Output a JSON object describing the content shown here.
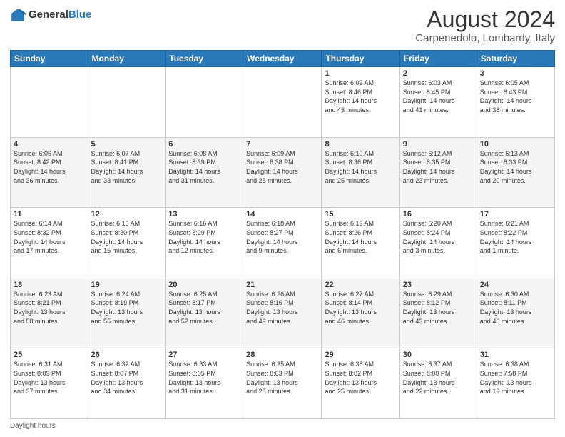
{
  "logo": {
    "general": "General",
    "blue": "Blue"
  },
  "title": "August 2024",
  "subtitle": "Carpenedolo, Lombardy, Italy",
  "footer": "Daylight hours",
  "weekdays": [
    "Sunday",
    "Monday",
    "Tuesday",
    "Wednesday",
    "Thursday",
    "Friday",
    "Saturday"
  ],
  "weeks": [
    [
      {
        "day": "",
        "info": ""
      },
      {
        "day": "",
        "info": ""
      },
      {
        "day": "",
        "info": ""
      },
      {
        "day": "",
        "info": ""
      },
      {
        "day": "1",
        "info": "Sunrise: 6:02 AM\nSunset: 8:46 PM\nDaylight: 14 hours\nand 43 minutes."
      },
      {
        "day": "2",
        "info": "Sunrise: 6:03 AM\nSunset: 8:45 PM\nDaylight: 14 hours\nand 41 minutes."
      },
      {
        "day": "3",
        "info": "Sunrise: 6:05 AM\nSunset: 8:43 PM\nDaylight: 14 hours\nand 38 minutes."
      }
    ],
    [
      {
        "day": "4",
        "info": "Sunrise: 6:06 AM\nSunset: 8:42 PM\nDaylight: 14 hours\nand 36 minutes."
      },
      {
        "day": "5",
        "info": "Sunrise: 6:07 AM\nSunset: 8:41 PM\nDaylight: 14 hours\nand 33 minutes."
      },
      {
        "day": "6",
        "info": "Sunrise: 6:08 AM\nSunset: 8:39 PM\nDaylight: 14 hours\nand 31 minutes."
      },
      {
        "day": "7",
        "info": "Sunrise: 6:09 AM\nSunset: 8:38 PM\nDaylight: 14 hours\nand 28 minutes."
      },
      {
        "day": "8",
        "info": "Sunrise: 6:10 AM\nSunset: 8:36 PM\nDaylight: 14 hours\nand 25 minutes."
      },
      {
        "day": "9",
        "info": "Sunrise: 6:12 AM\nSunset: 8:35 PM\nDaylight: 14 hours\nand 23 minutes."
      },
      {
        "day": "10",
        "info": "Sunrise: 6:13 AM\nSunset: 8:33 PM\nDaylight: 14 hours\nand 20 minutes."
      }
    ],
    [
      {
        "day": "11",
        "info": "Sunrise: 6:14 AM\nSunset: 8:32 PM\nDaylight: 14 hours\nand 17 minutes."
      },
      {
        "day": "12",
        "info": "Sunrise: 6:15 AM\nSunset: 8:30 PM\nDaylight: 14 hours\nand 15 minutes."
      },
      {
        "day": "13",
        "info": "Sunrise: 6:16 AM\nSunset: 8:29 PM\nDaylight: 14 hours\nand 12 minutes."
      },
      {
        "day": "14",
        "info": "Sunrise: 6:18 AM\nSunset: 8:27 PM\nDaylight: 14 hours\nand 9 minutes."
      },
      {
        "day": "15",
        "info": "Sunrise: 6:19 AM\nSunset: 8:26 PM\nDaylight: 14 hours\nand 6 minutes."
      },
      {
        "day": "16",
        "info": "Sunrise: 6:20 AM\nSunset: 8:24 PM\nDaylight: 14 hours\nand 3 minutes."
      },
      {
        "day": "17",
        "info": "Sunrise: 6:21 AM\nSunset: 8:22 PM\nDaylight: 14 hours\nand 1 minute."
      }
    ],
    [
      {
        "day": "18",
        "info": "Sunrise: 6:23 AM\nSunset: 8:21 PM\nDaylight: 13 hours\nand 58 minutes."
      },
      {
        "day": "19",
        "info": "Sunrise: 6:24 AM\nSunset: 8:19 PM\nDaylight: 13 hours\nand 55 minutes."
      },
      {
        "day": "20",
        "info": "Sunrise: 6:25 AM\nSunset: 8:17 PM\nDaylight: 13 hours\nand 52 minutes."
      },
      {
        "day": "21",
        "info": "Sunrise: 6:26 AM\nSunset: 8:16 PM\nDaylight: 13 hours\nand 49 minutes."
      },
      {
        "day": "22",
        "info": "Sunrise: 6:27 AM\nSunset: 8:14 PM\nDaylight: 13 hours\nand 46 minutes."
      },
      {
        "day": "23",
        "info": "Sunrise: 6:29 AM\nSunset: 8:12 PM\nDaylight: 13 hours\nand 43 minutes."
      },
      {
        "day": "24",
        "info": "Sunrise: 6:30 AM\nSunset: 8:11 PM\nDaylight: 13 hours\nand 40 minutes."
      }
    ],
    [
      {
        "day": "25",
        "info": "Sunrise: 6:31 AM\nSunset: 8:09 PM\nDaylight: 13 hours\nand 37 minutes."
      },
      {
        "day": "26",
        "info": "Sunrise: 6:32 AM\nSunset: 8:07 PM\nDaylight: 13 hours\nand 34 minutes."
      },
      {
        "day": "27",
        "info": "Sunrise: 6:33 AM\nSunset: 8:05 PM\nDaylight: 13 hours\nand 31 minutes."
      },
      {
        "day": "28",
        "info": "Sunrise: 6:35 AM\nSunset: 8:03 PM\nDaylight: 13 hours\nand 28 minutes."
      },
      {
        "day": "29",
        "info": "Sunrise: 6:36 AM\nSunset: 8:02 PM\nDaylight: 13 hours\nand 25 minutes."
      },
      {
        "day": "30",
        "info": "Sunrise: 6:37 AM\nSunset: 8:00 PM\nDaylight: 13 hours\nand 22 minutes."
      },
      {
        "day": "31",
        "info": "Sunrise: 6:38 AM\nSunset: 7:58 PM\nDaylight: 13 hours\nand 19 minutes."
      }
    ]
  ]
}
